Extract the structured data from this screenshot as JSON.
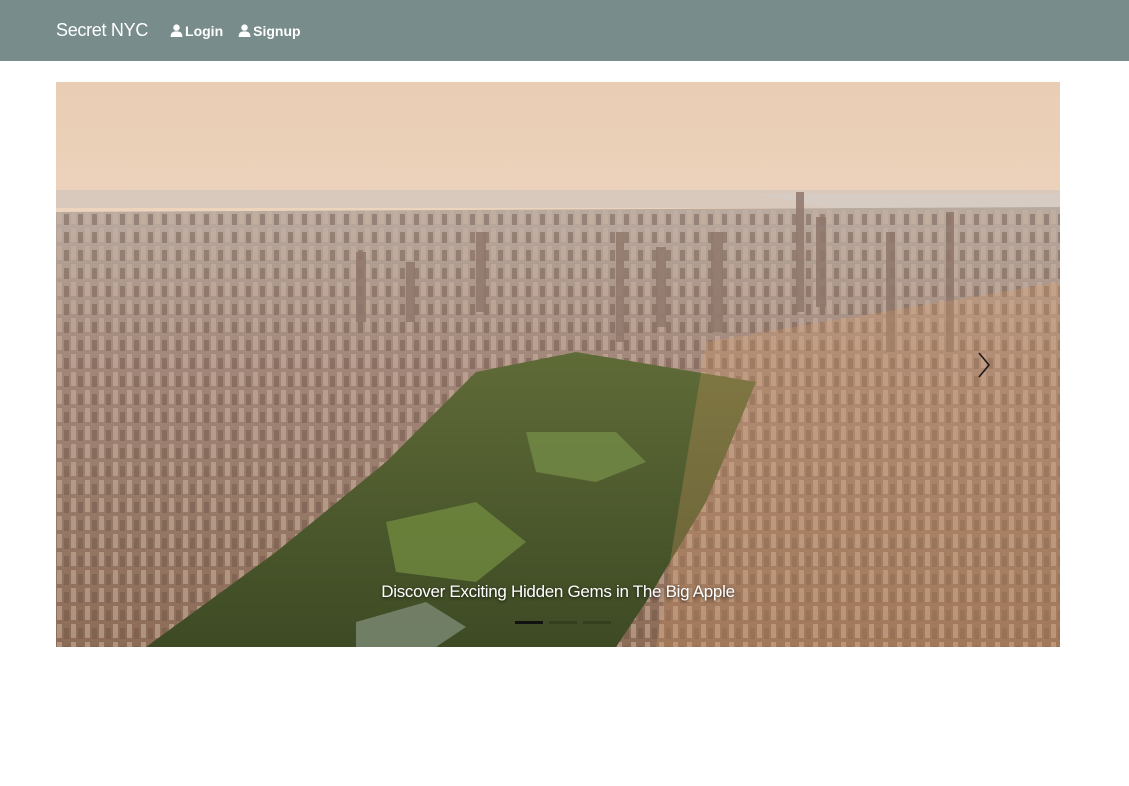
{
  "navbar": {
    "brand": "Secret NYC",
    "links": [
      {
        "label": "Login",
        "icon": "user-icon"
      },
      {
        "label": "Signup",
        "icon": "user-icon"
      }
    ],
    "background": "#788c8c"
  },
  "carousel": {
    "caption": "Discover Exciting Hidden Gems in The Big Apple",
    "slide_count": 3,
    "active_index": 0,
    "image": "aerial-central-park-manhattan",
    "next_icon": "chevron-right-icon"
  }
}
